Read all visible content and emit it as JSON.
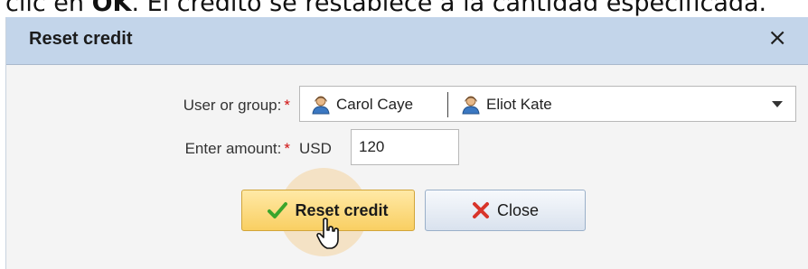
{
  "doc_line": {
    "prefix": "clic en ",
    "bold": "OK",
    "suffix": ". El crédito se restablece a la cantidad especificada."
  },
  "dialog": {
    "title": "Reset credit",
    "close_symbol": "×"
  },
  "form": {
    "user_label": "User or group:",
    "required_mark": "*",
    "users": [
      {
        "name": "Carol Caye",
        "icon": "user-icon"
      },
      {
        "name": "Eliot Kate",
        "icon": "user-icon"
      }
    ],
    "amount_label": "Enter amount:",
    "currency": "USD",
    "amount_value": "120"
  },
  "buttons": {
    "reset_label": "Reset credit",
    "close_label": "Close"
  },
  "colors": {
    "titlebar": "#c3d5ea",
    "required": "#d01010",
    "reset_button": "#f9cf62",
    "checkmark": "#3aa52c",
    "close_x": "#d8342a"
  }
}
